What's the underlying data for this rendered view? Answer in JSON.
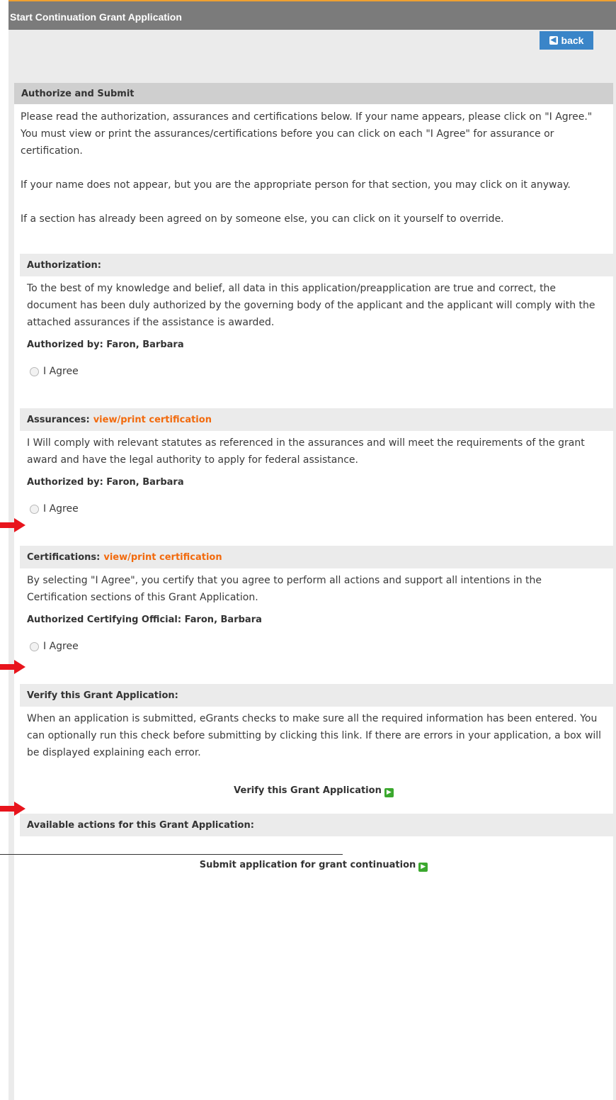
{
  "title": "Start Continuation Grant Application",
  "back": {
    "label": "back",
    "icon": "back-arrow-icon"
  },
  "main_header": "Authorize and Submit",
  "intro": {
    "p1": "Please read the authorization, assurances and certifications below. If your name appears, please click on \"I Agree.\" You must view or print the assurances/certifications before you can click on each \"I Agree\" for assurance or certification.",
    "p2": "If your name does not appear, but you are the appropriate person for that section, you may click on it anyway.",
    "p3": "If a section has already been agreed on by someone else, you can click on it yourself to override."
  },
  "authorization": {
    "heading": "Authorization:",
    "text": "To the best of my knowledge and belief, all data in this application/preapplication are true and correct, the document has been duly authorized by the governing body of the applicant and the applicant will comply with the attached assurances if the assistance is awarded.",
    "authorized_by": "Authorized by: Faron, Barbara",
    "agree": "I Agree"
  },
  "assurances": {
    "heading": "Assurances:",
    "link": "view/print certification",
    "text": "I Will comply with relevant statutes as referenced in the assurances and will meet the requirements of the grant award and have the legal authority to apply for federal assistance.",
    "authorized_by": "Authorized by: Faron, Barbara",
    "agree": "I Agree"
  },
  "certifications": {
    "heading": "Certifications:",
    "link": "view/print certification",
    "text": "By selecting \"I Agree\", you certify that you agree to perform all actions and support all intentions in the Certification sections of this Grant Application.",
    "authorized_by": "Authorized Certifying Official: Faron, Barbara",
    "agree": "I Agree"
  },
  "verify": {
    "heading": "Verify this Grant Application:",
    "text": "When an application is submitted, eGrants checks to make sure all the required information has been entered. You can optionally run this check before submitting by clicking this link. If there are errors in your application, a box will be displayed explaining each error.",
    "link": "Verify this Grant Application"
  },
  "actions": {
    "heading": "Available actions for this Grant Application:",
    "submit": "Submit application for grant continuation"
  },
  "colors": {
    "title_bar": "#7b7b7b",
    "accent_orange": "#f26a0d",
    "back_button": "#3a85c8",
    "go_icon": "#3ba82e",
    "annotation_arrow": "#e8141c"
  }
}
